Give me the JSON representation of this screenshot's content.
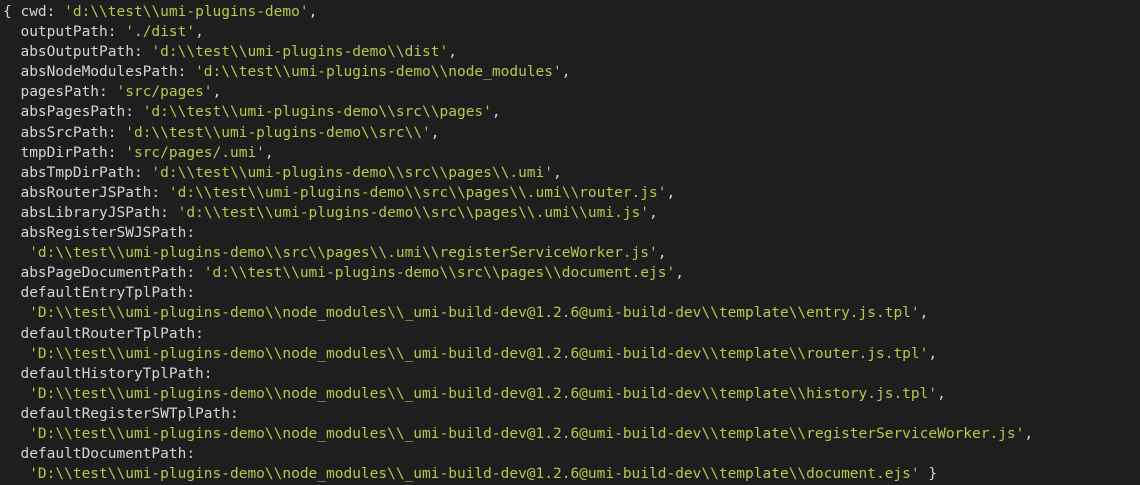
{
  "terminal": {
    "lines": [
      [
        {
          "t": "{ ",
          "c": "punct"
        },
        {
          "t": "cwd",
          "c": "key"
        },
        {
          "t": ": ",
          "c": "punct"
        },
        {
          "t": "'d:\\\\test\\\\umi-plugins-demo'",
          "c": "str"
        },
        {
          "t": ",",
          "c": "punct"
        }
      ],
      [
        {
          "t": "  outputPath",
          "c": "key"
        },
        {
          "t": ": ",
          "c": "punct"
        },
        {
          "t": "'./dist'",
          "c": "str"
        },
        {
          "t": ",",
          "c": "punct"
        }
      ],
      [
        {
          "t": "  absOutputPath",
          "c": "key"
        },
        {
          "t": ": ",
          "c": "punct"
        },
        {
          "t": "'d:\\\\test\\\\umi-plugins-demo\\\\dist'",
          "c": "str"
        },
        {
          "t": ",",
          "c": "punct"
        }
      ],
      [
        {
          "t": "  absNodeModulesPath",
          "c": "key"
        },
        {
          "t": ": ",
          "c": "punct"
        },
        {
          "t": "'d:\\\\test\\\\umi-plugins-demo\\\\node_modules'",
          "c": "str"
        },
        {
          "t": ",",
          "c": "punct"
        }
      ],
      [
        {
          "t": "  pagesPath",
          "c": "key"
        },
        {
          "t": ": ",
          "c": "punct"
        },
        {
          "t": "'src/pages'",
          "c": "str"
        },
        {
          "t": ",",
          "c": "punct"
        }
      ],
      [
        {
          "t": "  absPagesPath",
          "c": "key"
        },
        {
          "t": ": ",
          "c": "punct"
        },
        {
          "t": "'d:\\\\test\\\\umi-plugins-demo\\\\src\\\\pages'",
          "c": "str"
        },
        {
          "t": ",",
          "c": "punct"
        }
      ],
      [
        {
          "t": "  absSrcPath",
          "c": "key"
        },
        {
          "t": ": ",
          "c": "punct"
        },
        {
          "t": "'d:\\\\test\\\\umi-plugins-demo\\\\src\\\\'",
          "c": "str"
        },
        {
          "t": ",",
          "c": "punct"
        }
      ],
      [
        {
          "t": "  tmpDirPath",
          "c": "key"
        },
        {
          "t": ": ",
          "c": "punct"
        },
        {
          "t": "'src/pages/.umi'",
          "c": "str"
        },
        {
          "t": ",",
          "c": "punct"
        }
      ],
      [
        {
          "t": "  absTmpDirPath",
          "c": "key"
        },
        {
          "t": ": ",
          "c": "punct"
        },
        {
          "t": "'d:\\\\test\\\\umi-plugins-demo\\\\src\\\\pages\\\\.umi'",
          "c": "str"
        },
        {
          "t": ",",
          "c": "punct"
        }
      ],
      [
        {
          "t": "  absRouterJSPath",
          "c": "key"
        },
        {
          "t": ": ",
          "c": "punct"
        },
        {
          "t": "'d:\\\\test\\\\umi-plugins-demo\\\\src\\\\pages\\\\.umi\\\\router.js'",
          "c": "str"
        },
        {
          "t": ",",
          "c": "punct"
        }
      ],
      [
        {
          "t": "  absLibraryJSPath",
          "c": "key"
        },
        {
          "t": ": ",
          "c": "punct"
        },
        {
          "t": "'d:\\\\test\\\\umi-plugins-demo\\\\src\\\\pages\\\\.umi\\\\umi.js'",
          "c": "str"
        },
        {
          "t": ",",
          "c": "punct"
        }
      ],
      [
        {
          "t": "  absRegisterSWJSPath",
          "c": "key"
        },
        {
          "t": ":",
          "c": "punct"
        }
      ],
      [
        {
          "t": "   ",
          "c": "punct"
        },
        {
          "t": "'d:\\\\test\\\\umi-plugins-demo\\\\src\\\\pages\\\\.umi\\\\registerServiceWorker.js'",
          "c": "str"
        },
        {
          "t": ",",
          "c": "punct"
        }
      ],
      [
        {
          "t": "  absPageDocumentPath",
          "c": "key"
        },
        {
          "t": ": ",
          "c": "punct"
        },
        {
          "t": "'d:\\\\test\\\\umi-plugins-demo\\\\src\\\\pages\\\\document.ejs'",
          "c": "str"
        },
        {
          "t": ",",
          "c": "punct"
        }
      ],
      [
        {
          "t": "  defaultEntryTplPath",
          "c": "key"
        },
        {
          "t": ":",
          "c": "punct"
        }
      ],
      [
        {
          "t": "   ",
          "c": "punct"
        },
        {
          "t": "'D:\\\\test\\\\umi-plugins-demo\\\\node_modules\\\\_umi-build-dev@1.2.6@umi-build-dev\\\\template\\\\entry.js.tpl'",
          "c": "str"
        },
        {
          "t": ",",
          "c": "punct"
        }
      ],
      [
        {
          "t": "  defaultRouterTplPath",
          "c": "key"
        },
        {
          "t": ":",
          "c": "punct"
        }
      ],
      [
        {
          "t": "   ",
          "c": "punct"
        },
        {
          "t": "'D:\\\\test\\\\umi-plugins-demo\\\\node_modules\\\\_umi-build-dev@1.2.6@umi-build-dev\\\\template\\\\router.js.tpl'",
          "c": "str"
        },
        {
          "t": ",",
          "c": "punct"
        }
      ],
      [
        {
          "t": "  defaultHistoryTplPath",
          "c": "key"
        },
        {
          "t": ":",
          "c": "punct"
        }
      ],
      [
        {
          "t": "   ",
          "c": "punct"
        },
        {
          "t": "'D:\\\\test\\\\umi-plugins-demo\\\\node_modules\\\\_umi-build-dev@1.2.6@umi-build-dev\\\\template\\\\history.js.tpl'",
          "c": "str"
        },
        {
          "t": ",",
          "c": "punct"
        }
      ],
      [
        {
          "t": "  defaultRegisterSWTplPath",
          "c": "key"
        },
        {
          "t": ":",
          "c": "punct"
        }
      ],
      [
        {
          "t": "   ",
          "c": "punct"
        },
        {
          "t": "'D:\\\\test\\\\umi-plugins-demo\\\\node_modules\\\\_umi-build-dev@1.2.6@umi-build-dev\\\\template\\\\registerServiceWorker.js'",
          "c": "str"
        },
        {
          "t": ",",
          "c": "punct"
        }
      ],
      [
        {
          "t": "  defaultDocumentPath",
          "c": "key"
        },
        {
          "t": ":",
          "c": "punct"
        }
      ],
      [
        {
          "t": "   ",
          "c": "punct"
        },
        {
          "t": "'D:\\\\test\\\\umi-plugins-demo\\\\node_modules\\\\_umi-build-dev@1.2.6@umi-build-dev\\\\template\\\\document.ejs'",
          "c": "str"
        },
        {
          "t": " }",
          "c": "punct"
        }
      ]
    ]
  },
  "colors": {
    "background": "#1e1e1e",
    "key": "#d4d4d4",
    "string": "#b5c94a"
  }
}
